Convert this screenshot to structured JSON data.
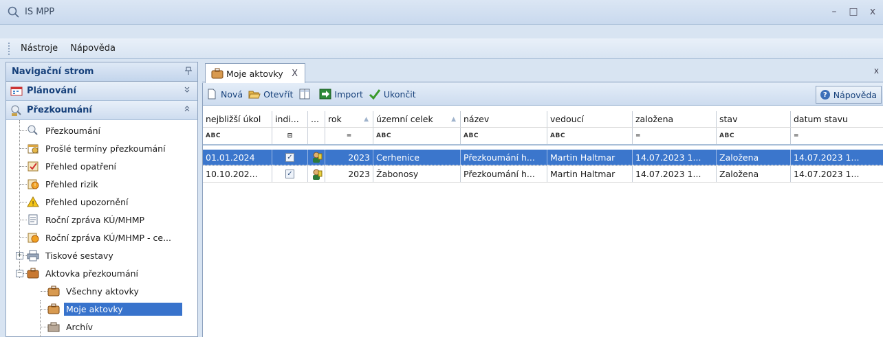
{
  "window": {
    "title": "IS MPP",
    "controls": [
      "–",
      "□",
      "x"
    ]
  },
  "menu": {
    "items": [
      "Nástroje",
      "Nápověda"
    ]
  },
  "nav": {
    "header": "Navigační strom",
    "pin_symbol": "ꟸ",
    "groups": [
      {
        "label": "Plánování",
        "chevron": "≚"
      },
      {
        "label": "Přezkoumání",
        "chevron": "≙"
      }
    ],
    "items": [
      {
        "label": "Přezkoumání",
        "icon": "review-icon"
      },
      {
        "label": "Prošlé termíny přezkoumání",
        "icon": "calendar-icon"
      },
      {
        "label": "Přehled opatření",
        "icon": "checklist-icon"
      },
      {
        "label": "Přehled rizik",
        "icon": "risk-icon"
      },
      {
        "label": "Přehled upozornění",
        "icon": "warning-icon"
      },
      {
        "label": "Roční zpráva KÚ/MHMP",
        "icon": "report-icon"
      },
      {
        "label": "Roční zpráva KÚ/MHMP - ce...",
        "icon": "report-risk-icon"
      },
      {
        "label": "Tiskové sestavy",
        "icon": "print-icon"
      },
      {
        "label": "Aktovka přezkoumání",
        "icon": "briefcase-icon"
      },
      {
        "label": "Všechny aktovky",
        "icon": "briefcase-small-icon"
      },
      {
        "label": "Moje aktovky",
        "icon": "briefcase-small-icon"
      },
      {
        "label": "Archív",
        "icon": "archive-icon"
      }
    ]
  },
  "tab": {
    "label": "Moje aktovky",
    "close": "X",
    "close_all": "x"
  },
  "toolbar": {
    "new": "Nová",
    "open": "Otevřít",
    "import": "Import",
    "finish": "Ukončit",
    "help": "Nápověda"
  },
  "grid": {
    "columns": [
      "nejbližší úkol",
      "indi...",
      "...",
      "rok",
      "územní celek",
      "název",
      "vedoucí",
      "založena",
      "stav",
      "datum stavu"
    ],
    "filters": [
      "ABC",
      "⊟",
      "",
      "=",
      "ABC",
      "ABC",
      "ABC",
      "=",
      "ABC",
      "="
    ],
    "rows": [
      {
        "task": "01.01.2024",
        "checked": "✓",
        "year": "2023",
        "area": "Cerhenice",
        "name": "Přezkoumání h...",
        "lead": "Martin Haltmar",
        "created": "14.07.2023 1...",
        "state": "Založena",
        "state_date": "14.07.2023 1...",
        "selected": true
      },
      {
        "task": "10.10.202...",
        "checked": "✓",
        "year": "2023",
        "area": "Žabonosy",
        "name": "Přezkoumání h...",
        "lead": "Martin Haltmar",
        "created": "14.07.2023 1...",
        "state": "Založena",
        "state_date": "14.07.2023 1...",
        "selected": false
      }
    ]
  },
  "colors": {
    "accent": "#3873cc",
    "header_text": "#16407a",
    "panel_bg": "#d8e4f2"
  }
}
